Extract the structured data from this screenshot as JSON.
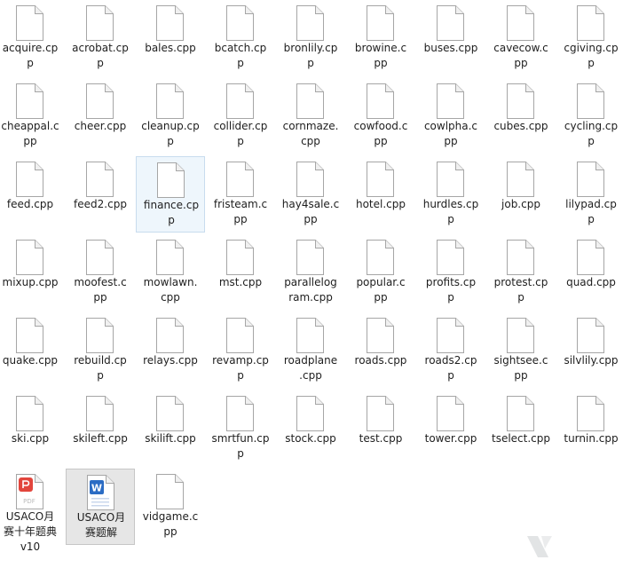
{
  "files": [
    {
      "lines": [
        "acquire.cp",
        "p"
      ],
      "icon": "document-icon"
    },
    {
      "lines": [
        "acrobat.cp",
        "p"
      ],
      "icon": "document-icon"
    },
    {
      "lines": [
        "bales.cpp"
      ],
      "icon": "document-icon"
    },
    {
      "lines": [
        "bcatch.cp",
        "p"
      ],
      "icon": "document-icon"
    },
    {
      "lines": [
        "bronlily.cp",
        "p"
      ],
      "icon": "document-icon"
    },
    {
      "lines": [
        "browine.c",
        "pp"
      ],
      "icon": "document-icon"
    },
    {
      "lines": [
        "buses.cpp"
      ],
      "icon": "document-icon"
    },
    {
      "lines": [
        "cavecow.c",
        "pp"
      ],
      "icon": "document-icon"
    },
    {
      "lines": [
        "cgiving.cp",
        "p"
      ],
      "icon": "document-icon"
    },
    {
      "lines": [
        "cheappal.c",
        "pp"
      ],
      "icon": "document-icon"
    },
    {
      "lines": [
        "cheer.cpp"
      ],
      "icon": "document-icon"
    },
    {
      "lines": [
        "cleanup.cp",
        "p"
      ],
      "icon": "document-icon"
    },
    {
      "lines": [
        "collider.cp",
        "p"
      ],
      "icon": "document-icon"
    },
    {
      "lines": [
        "cornmaze.",
        "cpp"
      ],
      "icon": "document-icon"
    },
    {
      "lines": [
        "cowfood.c",
        "pp"
      ],
      "icon": "document-icon"
    },
    {
      "lines": [
        "cowlpha.c",
        "pp"
      ],
      "icon": "document-icon"
    },
    {
      "lines": [
        "cubes.cpp"
      ],
      "icon": "document-icon"
    },
    {
      "lines": [
        "cycling.cp",
        "p"
      ],
      "icon": "document-icon"
    },
    {
      "lines": [
        "feed.cpp"
      ],
      "icon": "document-icon"
    },
    {
      "lines": [
        "feed2.cpp"
      ],
      "icon": "document-icon"
    },
    {
      "lines": [
        "finance.cp",
        "p"
      ],
      "icon": "document-icon",
      "state": "hl"
    },
    {
      "lines": [
        "fristeam.c",
        "pp"
      ],
      "icon": "document-icon"
    },
    {
      "lines": [
        "hay4sale.c",
        "pp"
      ],
      "icon": "document-icon"
    },
    {
      "lines": [
        "hotel.cpp"
      ],
      "icon": "document-icon"
    },
    {
      "lines": [
        "hurdles.cp",
        "p"
      ],
      "icon": "document-icon"
    },
    {
      "lines": [
        "job.cpp"
      ],
      "icon": "document-icon"
    },
    {
      "lines": [
        "lilypad.cp",
        "p"
      ],
      "icon": "document-icon"
    },
    {
      "lines": [
        "mixup.cpp"
      ],
      "icon": "document-icon"
    },
    {
      "lines": [
        "moofest.c",
        "pp"
      ],
      "icon": "document-icon"
    },
    {
      "lines": [
        "mowlawn.",
        "cpp"
      ],
      "icon": "document-icon"
    },
    {
      "lines": [
        "mst.cpp"
      ],
      "icon": "document-icon"
    },
    {
      "lines": [
        "parallelog",
        "ram.cpp"
      ],
      "icon": "document-icon"
    },
    {
      "lines": [
        "popular.c",
        "pp"
      ],
      "icon": "document-icon"
    },
    {
      "lines": [
        "profits.cp",
        "p"
      ],
      "icon": "document-icon"
    },
    {
      "lines": [
        "protest.cp",
        "p"
      ],
      "icon": "document-icon"
    },
    {
      "lines": [
        "quad.cpp"
      ],
      "icon": "document-icon"
    },
    {
      "lines": [
        "quake.cpp"
      ],
      "icon": "document-icon"
    },
    {
      "lines": [
        "rebuild.cp",
        "p"
      ],
      "icon": "document-icon"
    },
    {
      "lines": [
        "relays.cpp"
      ],
      "icon": "document-icon"
    },
    {
      "lines": [
        "revamp.cp",
        "p"
      ],
      "icon": "document-icon"
    },
    {
      "lines": [
        "roadplane",
        ".cpp"
      ],
      "icon": "document-icon"
    },
    {
      "lines": [
        "roads.cpp"
      ],
      "icon": "document-icon"
    },
    {
      "lines": [
        "roads2.cp",
        "p"
      ],
      "icon": "document-icon"
    },
    {
      "lines": [
        "sightsee.c",
        "pp"
      ],
      "icon": "document-icon"
    },
    {
      "lines": [
        "silvlily.cpp"
      ],
      "icon": "document-icon"
    },
    {
      "lines": [
        "ski.cpp"
      ],
      "icon": "document-icon"
    },
    {
      "lines": [
        "skileft.cpp"
      ],
      "icon": "document-icon"
    },
    {
      "lines": [
        "skilift.cpp"
      ],
      "icon": "document-icon"
    },
    {
      "lines": [
        "smrtfun.cp",
        "p"
      ],
      "icon": "document-icon"
    },
    {
      "lines": [
        "stock.cpp"
      ],
      "icon": "document-icon"
    },
    {
      "lines": [
        "test.cpp"
      ],
      "icon": "document-icon"
    },
    {
      "lines": [
        "tower.cpp"
      ],
      "icon": "document-icon"
    },
    {
      "lines": [
        "tselect.cpp"
      ],
      "icon": "document-icon"
    },
    {
      "lines": [
        "turnin.cpp"
      ],
      "icon": "document-icon"
    },
    {
      "lines": [
        "USACO月",
        "赛十年题典",
        "v10"
      ],
      "icon": "pdf-icon",
      "badge": "PDF"
    },
    {
      "lines": [
        "USACO月",
        "赛题解"
      ],
      "icon": "word-icon",
      "badge": "W",
      "state": "sel"
    },
    {
      "lines": [
        "vidgame.c",
        "pp"
      ],
      "icon": "document-icon"
    }
  ],
  "colors": {
    "pdf_accent": "#e2453c",
    "word_accent": "#2b6cc4",
    "hover_bg": "#eef6fc",
    "selected_bg": "#e6e6e6"
  }
}
